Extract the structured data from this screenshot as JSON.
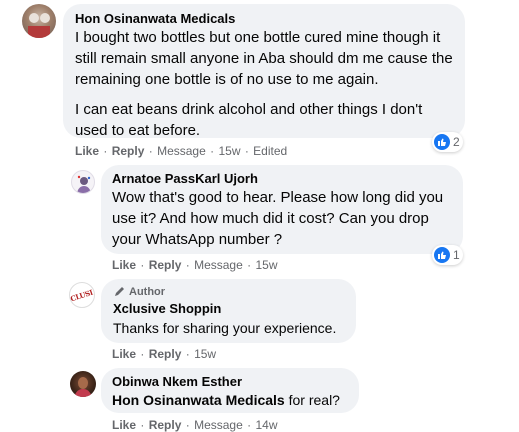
{
  "comments": [
    {
      "author": "Hon Osinanwata Medicals",
      "paragraph1": "I bought two bottles but one bottle cured mine though it still remain small anyone in Aba should dm me cause the remaining one bottle is of no use to me again.",
      "paragraph2": "I can eat beans drink alcohol and other things I don't used to eat before.",
      "actions": {
        "like": "Like",
        "reply": "Reply",
        "message": "Message",
        "time": "15w",
        "edited": "Edited"
      },
      "reactions": "2"
    },
    {
      "author": "Arnatoe PassKarl Ujorh",
      "text": "Wow that's good to hear. Please how long did you use it? And how much did it cost? Can you drop your WhatsApp number ?",
      "actions": {
        "like": "Like",
        "reply": "Reply",
        "message": "Message",
        "time": "15w"
      },
      "reactions": "1"
    },
    {
      "badge": "Author",
      "author": "Xclusive Shoppin",
      "avatar_text": "CLUSI",
      "text": "Thanks for sharing your experience.",
      "actions": {
        "like": "Like",
        "reply": "Reply",
        "time": "15w"
      }
    },
    {
      "author": "Obinwa Nkem Esther",
      "mention": "Hon Osinanwata Medicals",
      "text": " for real?",
      "actions": {
        "like": "Like",
        "reply": "Reply",
        "message": "Message",
        "time": "14w"
      }
    }
  ],
  "colors": {
    "bubble": "#f0f2f5",
    "like_blue": "#1877f2",
    "meta_gray": "#65676b"
  }
}
